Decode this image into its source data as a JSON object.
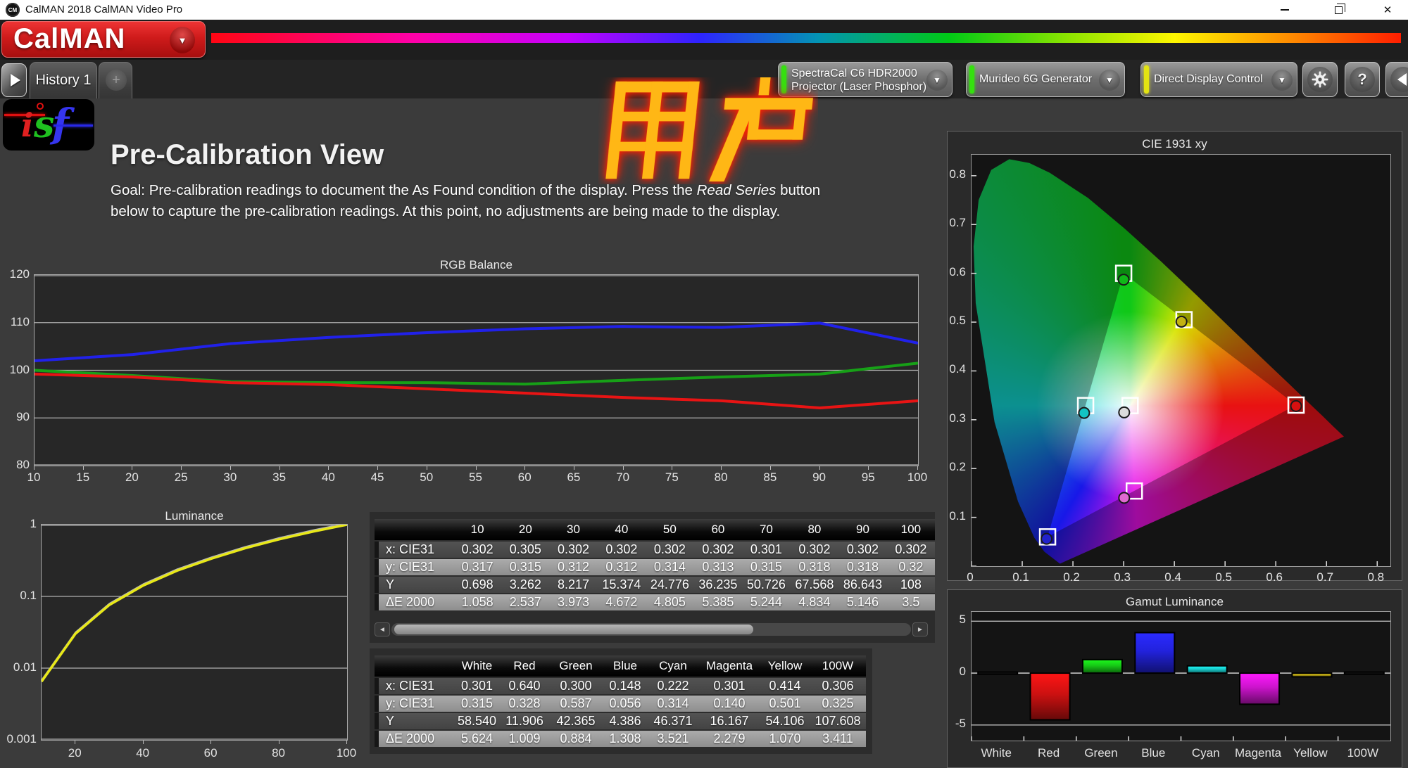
{
  "window": {
    "title": "CalMAN 2018 CalMAN Video Pro"
  },
  "icons": {
    "app_logo": "CM",
    "brand_dropdown": "▼",
    "nav_forward": "▶",
    "tab_add": "+",
    "device_dropdown": "▼",
    "gear": "⚙",
    "help": "?",
    "collapse_panel": "◀",
    "scroll_left": "◄",
    "scroll_right": "►",
    "minimize": "–",
    "restore": "❐",
    "close": "✕"
  },
  "brand": {
    "logo_text": "CalMAN",
    "isf_i": "i",
    "isf_s": "s",
    "isf_f": "f"
  },
  "tabs": {
    "history_label": "History 1"
  },
  "devices": [
    {
      "line1": "SpectraCal C6 HDR2000",
      "line2": "Projector (Laser Phosphor)",
      "status_color": "#35e00f"
    },
    {
      "line1": "Murideo 6G Generator",
      "line2": "",
      "status_color": "#35e00f"
    },
    {
      "line1": "Direct Display Control",
      "line2": "",
      "status_color": "#e3e312"
    }
  ],
  "page": {
    "title": "Pre-Calibration View",
    "goal_line1_pre": "Goal: Pre-calibration readings to document the As Found condition of the display. Press the ",
    "goal_line1_em": "Read Series",
    "goal_line1_post": " button",
    "goal_line2": "below to capture the pre-calibration readings. At this point, no adjustments are being made to the display."
  },
  "watermark": {
    "text": "用户",
    "fill": "#ffb715",
    "glow": "#ff2000"
  },
  "chart_data": [
    {
      "id": "rgb_balance",
      "type": "line",
      "title": "RGB Balance",
      "x": [
        10,
        20,
        30,
        40,
        50,
        60,
        70,
        80,
        90,
        100
      ],
      "xticks": [
        10,
        15,
        20,
        25,
        30,
        35,
        40,
        45,
        50,
        55,
        60,
        65,
        70,
        75,
        80,
        85,
        90,
        95,
        100
      ],
      "yticks": [
        120,
        110,
        100,
        90,
        80
      ],
      "ylim": [
        80,
        120
      ],
      "series": [
        {
          "name": "Blue",
          "color": "#2121ea",
          "values": [
            102.0,
            103.3,
            105.6,
            106.9,
            107.9,
            108.7,
            109.2,
            109.0,
            109.9,
            105.7
          ]
        },
        {
          "name": "Green",
          "color": "#17a017",
          "values": [
            100.0,
            98.9,
            97.6,
            97.4,
            97.4,
            97.1,
            97.9,
            98.6,
            99.2,
            101.5
          ]
        },
        {
          "name": "Red",
          "color": "#e81414",
          "values": [
            99.2,
            98.6,
            97.4,
            97.0,
            96.1,
            95.2,
            94.3,
            93.6,
            92.1,
            93.6
          ]
        }
      ]
    },
    {
      "id": "luminance",
      "type": "line",
      "title": "Luminance",
      "x": [
        10,
        20,
        30,
        40,
        50,
        60,
        70,
        80,
        90,
        100
      ],
      "xticks": [
        20,
        40,
        60,
        80,
        100
      ],
      "yticks": [
        1,
        0.1,
        0.01,
        0.001
      ],
      "yscale": "log",
      "series": [
        {
          "name": "Luminance (normalized)",
          "color": "#e8e818",
          "values": [
            0.0065,
            0.0302,
            0.0761,
            0.1424,
            0.2294,
            0.3355,
            0.4697,
            0.6256,
            0.8022,
            1.0
          ]
        }
      ]
    },
    {
      "id": "cie1931",
      "type": "scatter",
      "title": "CIE 1931 xy",
      "xticks": [
        0,
        0.1,
        0.2,
        0.3,
        0.4,
        0.5,
        0.6,
        0.7,
        0.8
      ],
      "yticks": [
        0,
        0.1,
        0.2,
        0.3,
        0.4,
        0.5,
        0.6,
        0.7,
        0.8
      ],
      "xlim": [
        0,
        0.826
      ],
      "ylim": [
        0,
        0.843
      ],
      "gamut_triangle": [
        {
          "name": "Red",
          "x": 0.64,
          "y": 0.33
        },
        {
          "name": "Green",
          "x": 0.3,
          "y": 0.6
        },
        {
          "name": "Blue",
          "x": 0.15,
          "y": 0.06
        }
      ],
      "targets": [
        {
          "name": "White",
          "x": 0.3127,
          "y": 0.329
        },
        {
          "name": "Red",
          "x": 0.64,
          "y": 0.33
        },
        {
          "name": "Green",
          "x": 0.3,
          "y": 0.6
        },
        {
          "name": "Blue",
          "x": 0.15,
          "y": 0.06
        },
        {
          "name": "Cyan",
          "x": 0.225,
          "y": 0.329
        },
        {
          "name": "Magenta",
          "x": 0.321,
          "y": 0.154
        },
        {
          "name": "Yellow",
          "x": 0.419,
          "y": 0.505
        }
      ],
      "measurements": [
        {
          "name": "White",
          "x": 0.301,
          "y": 0.315,
          "color": "#dcdcdc"
        },
        {
          "name": "Red",
          "x": 0.64,
          "y": 0.328,
          "color": "#d81010"
        },
        {
          "name": "Green",
          "x": 0.3,
          "y": 0.587,
          "color": "#10b818"
        },
        {
          "name": "Blue",
          "x": 0.148,
          "y": 0.056,
          "color": "#2222cc"
        },
        {
          "name": "Cyan",
          "x": 0.222,
          "y": 0.314,
          "color": "#12c4c4"
        },
        {
          "name": "Magenta",
          "x": 0.301,
          "y": 0.14,
          "color": "#e06ad0"
        },
        {
          "name": "Yellow",
          "x": 0.414,
          "y": 0.501,
          "color": "#c2b212"
        }
      ]
    },
    {
      "id": "gamut_luminance",
      "type": "bar",
      "title": "Gamut Luminance",
      "categories": [
        "White",
        "Red",
        "Green",
        "Blue",
        "Cyan",
        "Magenta",
        "Yellow",
        "100W"
      ],
      "values": [
        0.0,
        -4.5,
        1.3,
        3.9,
        0.7,
        -3.0,
        -0.36,
        0.0
      ],
      "colors": [
        "#1a1a1a",
        "#cc1111",
        "#16c816",
        "#2222dd",
        "#18cccc",
        "#cc14cc",
        "#b8a414",
        "#1a1a1a"
      ],
      "yticks": [
        5,
        0,
        -5
      ],
      "ylim": [
        -6.5,
        5.9
      ]
    }
  ],
  "tables": [
    {
      "id": "grayscale_table",
      "columns": [
        "",
        "10",
        "20",
        "30",
        "40",
        "50",
        "60",
        "70",
        "80",
        "90",
        "100"
      ],
      "rows": [
        {
          "label": "x: CIE31",
          "values": [
            "0.302",
            "0.305",
            "0.302",
            "0.302",
            "0.302",
            "0.302",
            "0.301",
            "0.302",
            "0.302",
            "0.302"
          ]
        },
        {
          "label": "y: CIE31",
          "values": [
            "0.317",
            "0.315",
            "0.312",
            "0.312",
            "0.314",
            "0.313",
            "0.315",
            "0.318",
            "0.318",
            "0.32"
          ]
        },
        {
          "label": "Y",
          "values": [
            "0.698",
            "3.262",
            "8.217",
            "15.374",
            "24.776",
            "36.235",
            "50.726",
            "67.568",
            "86.643",
            "108"
          ]
        },
        {
          "label": "ΔE 2000",
          "values": [
            "1.058",
            "2.537",
            "3.973",
            "4.672",
            "4.805",
            "5.385",
            "5.244",
            "4.834",
            "5.146",
            "3.5"
          ]
        }
      ]
    },
    {
      "id": "gamut_table",
      "columns": [
        "",
        "White",
        "Red",
        "Green",
        "Blue",
        "Cyan",
        "Magenta",
        "Yellow",
        "100W"
      ],
      "rows": [
        {
          "label": "x: CIE31",
          "values": [
            "0.301",
            "0.640",
            "0.300",
            "0.148",
            "0.222",
            "0.301",
            "0.414",
            "0.306"
          ]
        },
        {
          "label": "y: CIE31",
          "values": [
            "0.315",
            "0.328",
            "0.587",
            "0.056",
            "0.314",
            "0.140",
            "0.501",
            "0.325"
          ]
        },
        {
          "label": "Y",
          "values": [
            "58.540",
            "11.906",
            "42.365",
            "4.386",
            "46.371",
            "16.167",
            "54.106",
            "107.608"
          ]
        },
        {
          "label": "ΔE 2000",
          "values": [
            "5.624",
            "1.009",
            "0.884",
            "1.308",
            "3.521",
            "2.279",
            "1.070",
            "3.411"
          ]
        }
      ]
    }
  ]
}
